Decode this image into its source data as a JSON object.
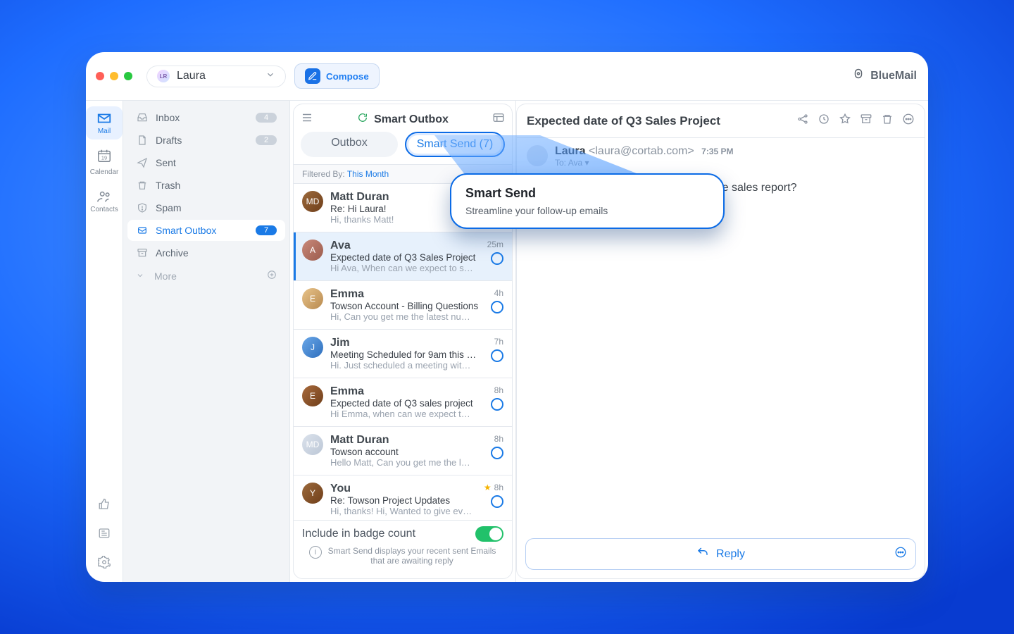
{
  "brand": {
    "name": "BlueMail"
  },
  "account": {
    "name": "Laura",
    "initials": "LR"
  },
  "compose_label": "Compose",
  "vnav": [
    {
      "key": "mail",
      "label": "Mail",
      "active": true
    },
    {
      "key": "calendar",
      "label": "Calendar",
      "day": "19"
    },
    {
      "key": "contacts",
      "label": "Contacts"
    }
  ],
  "folders": [
    {
      "key": "inbox",
      "label": "Inbox",
      "count": "4"
    },
    {
      "key": "drafts",
      "label": "Drafts",
      "count": "2"
    },
    {
      "key": "sent",
      "label": "Sent",
      "count": ""
    },
    {
      "key": "trash",
      "label": "Trash",
      "count": ""
    },
    {
      "key": "spam",
      "label": "Spam",
      "count": ""
    },
    {
      "key": "smart_outbox",
      "label": "Smart Outbox",
      "count": "7",
      "active": true
    },
    {
      "key": "archive",
      "label": "Archive",
      "count": ""
    }
  ],
  "folders_more": "More",
  "mid": {
    "title": "Smart Outbox",
    "tabs": {
      "outbox": "Outbox",
      "smart": "Smart Send (7)"
    },
    "filter": {
      "label": "Filtered By:",
      "value": "This Month"
    },
    "include_label": "Include in badge count",
    "include_on": true,
    "hint": "Smart Send displays your recent sent Emails that are awaiting reply"
  },
  "messages": [
    {
      "name": "Matt Duran",
      "subject": "Re: Hi Laura!",
      "preview": "Hi, thanks Matt!",
      "time": "",
      "starred": false,
      "selected": false
    },
    {
      "name": "Ava",
      "subject": "Expected date of Q3 Sales Project",
      "preview": "Hi Ava, When can we expect to s…",
      "time": "25m",
      "starred": false,
      "selected": true
    },
    {
      "name": "Emma",
      "subject": "Towson Account - Billing Questions",
      "preview": "Hi, Can you get me the latest nu…",
      "time": "4h",
      "starred": false,
      "selected": false
    },
    {
      "name": "Jim",
      "subject": "Meeting Scheduled for 9am this morn…",
      "preview": "Hi. Just scheduled a meeting wit…",
      "time": "7h",
      "starred": false,
      "selected": false
    },
    {
      "name": "Emma",
      "subject": "Expected date of Q3 sales project",
      "preview": "Hi Emma, when can we expect t…",
      "time": "8h",
      "starred": false,
      "selected": false
    },
    {
      "name": "Matt Duran",
      "subject": "Towson account",
      "preview": "Hello Matt, Can you get me the l…",
      "time": "8h",
      "starred": false,
      "selected": false
    },
    {
      "name": "You",
      "subject": "Re: Towson Project Updates",
      "preview": "Hi, thanks! Hi, Wanted to give ev…",
      "time": "8h",
      "starred": true,
      "selected": false
    }
  ],
  "reader": {
    "subject": "Expected date of Q3 Sales Project",
    "from_name": "Laura",
    "from_email": "<laura@cortab.com>",
    "to_label": "To:",
    "to_name": "Ava",
    "time": "7:35 PM",
    "body_visible": "the sales report?",
    "reply": "Reply"
  },
  "callout": {
    "title": "Smart Send",
    "text": "Streamline your follow-up emails"
  }
}
